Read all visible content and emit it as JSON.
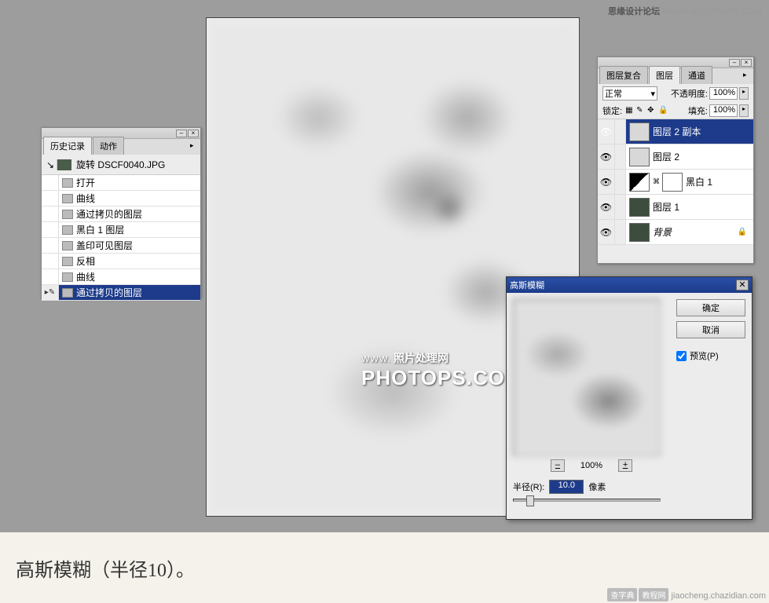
{
  "top_watermark": {
    "cn": "思缘设计论坛",
    "url": "WWW.MISSYUAN.COM"
  },
  "canvas_watermark": {
    "www": "WWW.",
    "txt": "照片处理网",
    "main": "PHOTOPS.COM"
  },
  "history": {
    "tabs": [
      "历史记录",
      "动作"
    ],
    "doc_name": "旋转 DSCF0040.JPG",
    "items": [
      {
        "label": "打开"
      },
      {
        "label": "曲线"
      },
      {
        "label": "通过拷贝的图层"
      },
      {
        "label": "黑白 1 图层"
      },
      {
        "label": "盖印可见图层"
      },
      {
        "label": "反相"
      },
      {
        "label": "曲线"
      },
      {
        "label": "通过拷贝的图层",
        "selected": true
      }
    ]
  },
  "layers": {
    "tabs": [
      "图层复合",
      "图层",
      "通道"
    ],
    "blend_mode": "正常",
    "opacity_label": "不透明度:",
    "opacity_value": "100%",
    "lock_label": "锁定:",
    "fill_label": "填充:",
    "fill_value": "100%",
    "items": [
      {
        "name": "图层 2 副本",
        "selected": true,
        "thumb": "light"
      },
      {
        "name": "图层 2",
        "thumb": "light"
      },
      {
        "name": "黑白 1",
        "thumb": "adj",
        "has_mask": true
      },
      {
        "name": "图层 1",
        "thumb": "dark"
      },
      {
        "name": "背景",
        "thumb": "dark",
        "locked": true,
        "bg": true
      }
    ]
  },
  "dialog": {
    "title": "高斯模糊",
    "ok": "确定",
    "cancel": "取消",
    "preview_label": "预览(P)",
    "zoom_value": "100%",
    "radius_label": "半径(R):",
    "radius_value": "10.0",
    "radius_unit": "像素"
  },
  "caption": "高斯模糊（半径10）。",
  "bottom_watermark": {
    "b1": "查字典",
    "b2": "教程网",
    "url": "jiaocheng.chazidian.com"
  }
}
